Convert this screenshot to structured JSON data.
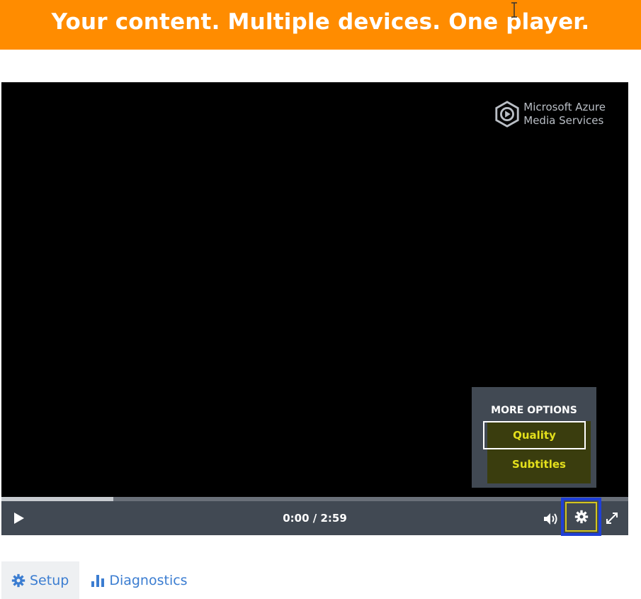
{
  "banner": {
    "title": "Your content. Multiple devices. One player.",
    "background": "#ff8c00"
  },
  "player": {
    "logo": {
      "icon": "azure-media-services-icon",
      "line1": "Microsoft Azure",
      "line2": "Media Services"
    },
    "more_options": {
      "heading": "MORE OPTIONS",
      "items": [
        {
          "label": "Quality",
          "focused": true
        },
        {
          "label": "Subtitles",
          "focused": false
        }
      ],
      "item_color": "#e4e01c"
    },
    "progress": {
      "played_fraction": 0.178
    },
    "controls": {
      "play_icon": "play-icon",
      "time": "0:00 / 2:59",
      "volume_icon": "volume-icon",
      "settings_icon": "gear-icon",
      "fullscreen_icon": "fullscreen-icon",
      "settings_highlight_color": "#1f3fd8"
    }
  },
  "tabs": [
    {
      "label": "Setup",
      "icon": "gear-icon",
      "selected": true
    },
    {
      "label": "Diagnostics",
      "icon": "bar-chart-icon",
      "selected": false
    }
  ],
  "colors": {
    "accent": "#3b7dd1",
    "control_bar": "#414953"
  }
}
